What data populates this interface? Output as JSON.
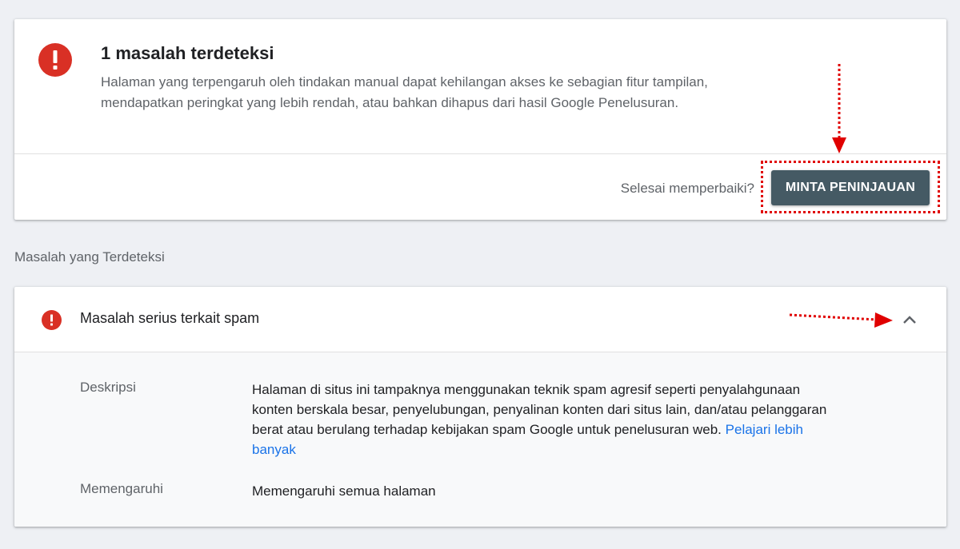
{
  "summary": {
    "title": "1 masalah terdeteksi",
    "description": "Halaman yang terpengaruh oleh tindakan manual dapat kehilangan akses ke sebagian fitur tampilan, mendapatkan peringkat yang lebih rendah, atau bahkan dihapus dari hasil Google Penelusuran.",
    "fixed_question": "Selesai memperbaiki?",
    "request_review_label": "MINTA PENINJAUAN",
    "icon": "error-icon"
  },
  "section_label": "Masalah yang Terdeteksi",
  "issue": {
    "title": "Masalah serius terkait spam",
    "icon": "error-icon",
    "expanded": true,
    "rows": [
      {
        "label": "Deskripsi",
        "value": "Halaman di situs ini tampaknya menggunakan teknik spam agresif seperti penyalahgunaan konten berskala besar, penyelubungan, penyalinan konten dari situs lain, dan/atau pelanggaran berat atau berulang terhadap kebijakan spam Google untuk penelusuran web.",
        "link": "Pelajari lebih banyak"
      },
      {
        "label": "Memengaruhi",
        "value": "Memengaruhi semua halaman"
      }
    ]
  },
  "colors": {
    "error": "#d93025",
    "button": "#455a64",
    "link": "#1a73e8",
    "annotation": "#e00000"
  }
}
